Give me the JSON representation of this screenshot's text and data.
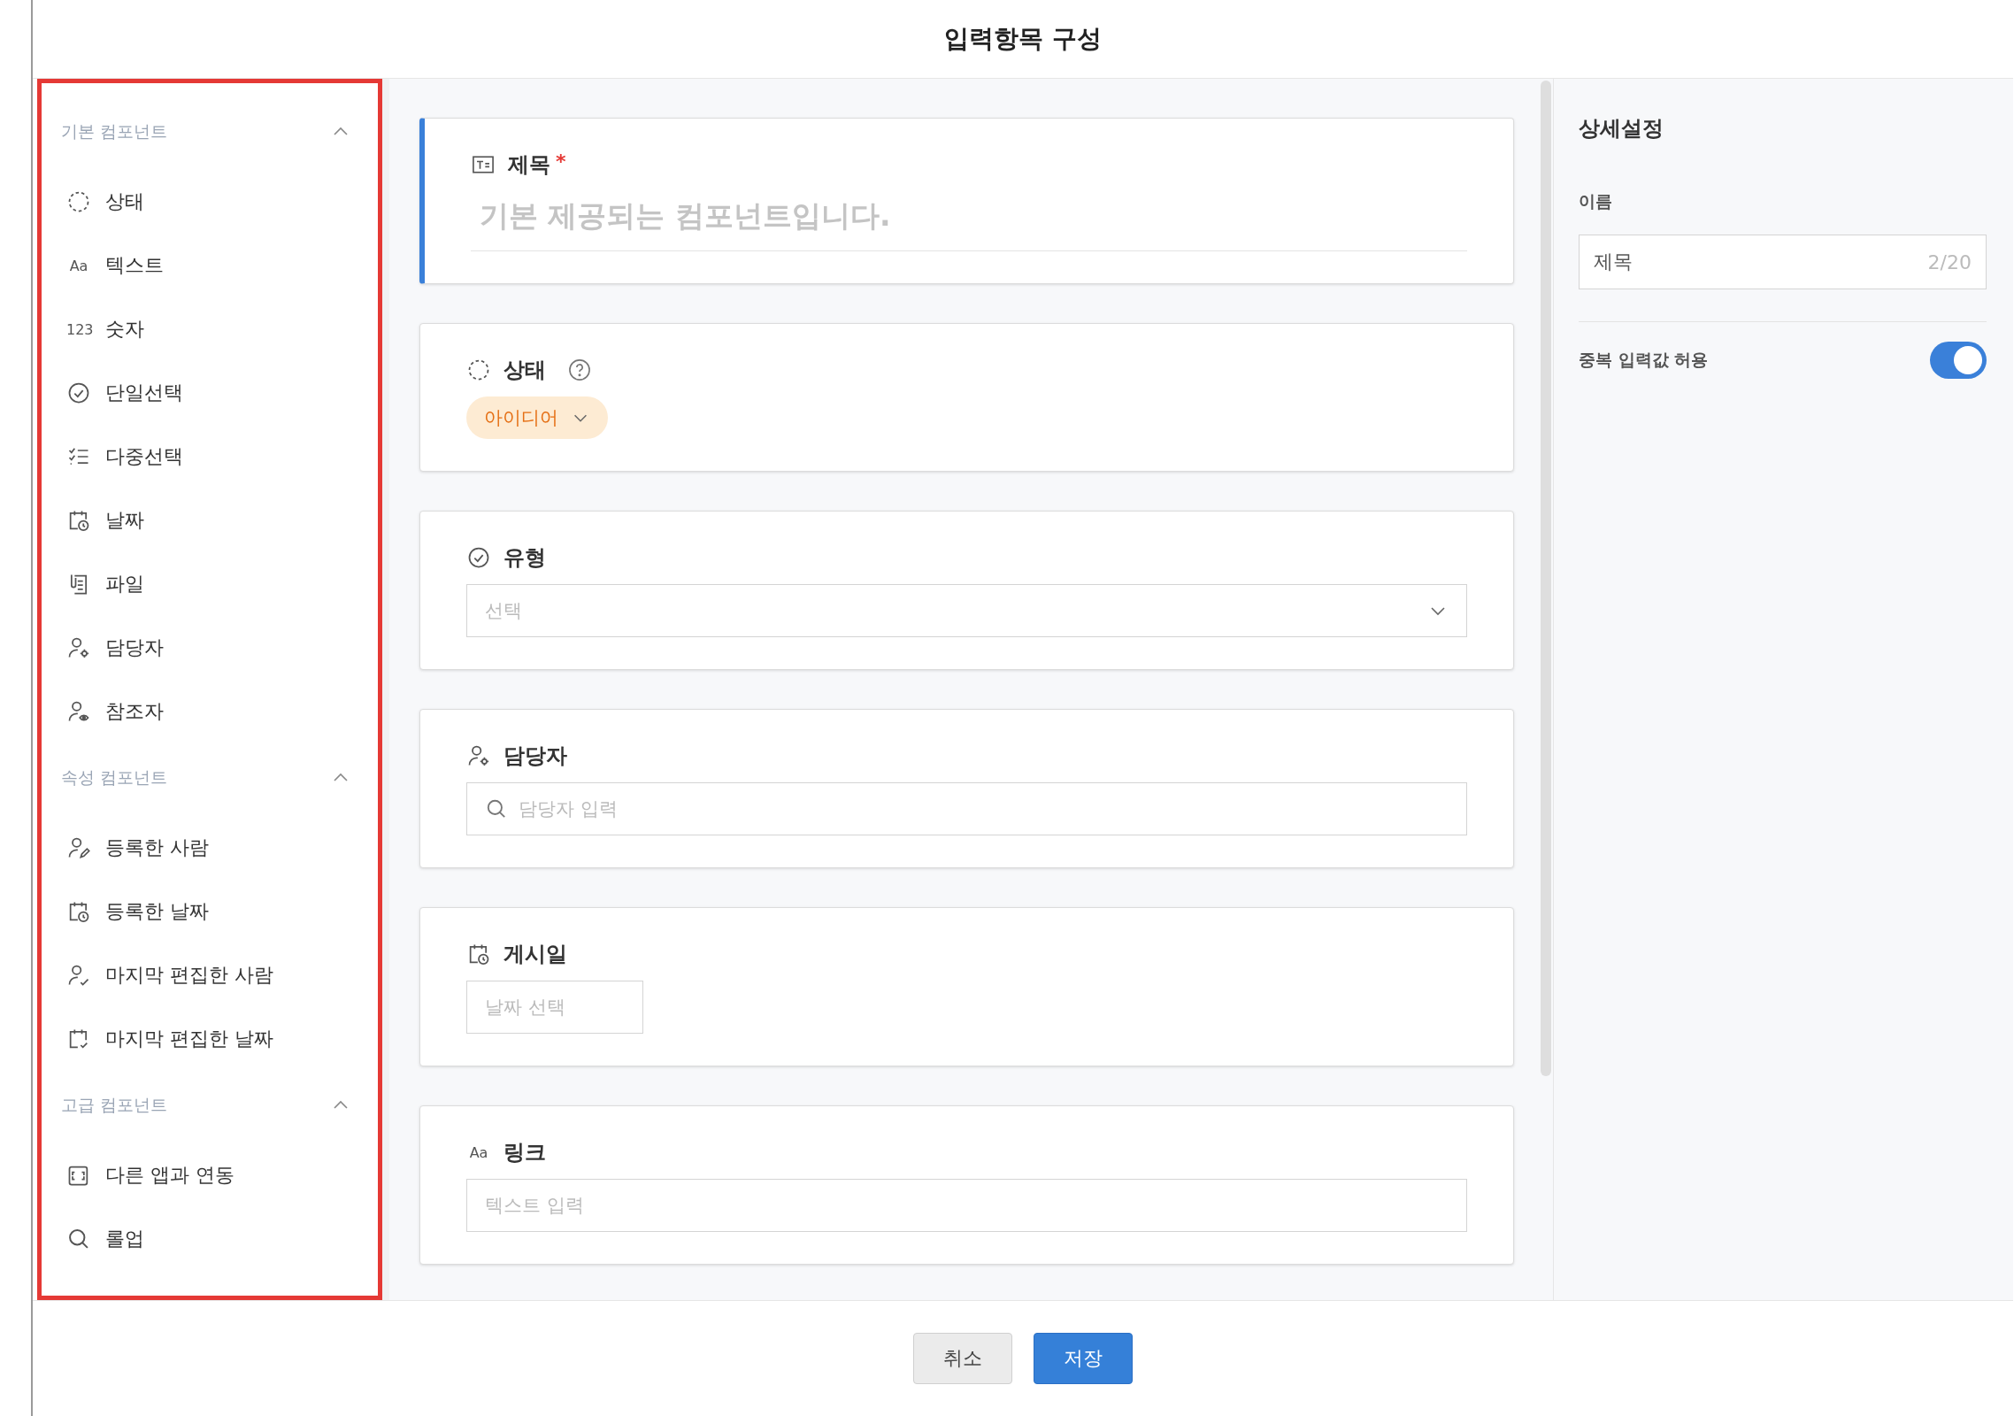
{
  "dialog": {
    "title": "입력항목 구성"
  },
  "sidebar": {
    "highlighted": true,
    "sections": [
      {
        "title": "기본 컴포넌트",
        "expanded": true,
        "items": [
          {
            "kind": "status",
            "label": "상태"
          },
          {
            "kind": "text",
            "glyph": "Aa",
            "label": "텍스트"
          },
          {
            "kind": "number",
            "glyph": "123",
            "label": "숫자"
          },
          {
            "kind": "single_select",
            "label": "단일선택"
          },
          {
            "kind": "multi_select",
            "label": "다중선택"
          },
          {
            "kind": "date",
            "label": "날짜"
          },
          {
            "kind": "file",
            "label": "파일"
          },
          {
            "kind": "assignee",
            "label": "담당자"
          },
          {
            "kind": "referrer",
            "label": "참조자"
          }
        ]
      },
      {
        "title": "속성 컴포넌트",
        "expanded": true,
        "items": [
          {
            "kind": "created_by",
            "label": "등록한 사람"
          },
          {
            "kind": "date",
            "label": "등록한 날짜"
          },
          {
            "kind": "edited_by",
            "label": "마지막 편집한 사람"
          },
          {
            "kind": "edited_at",
            "label": "마지막 편집한 날짜"
          }
        ]
      },
      {
        "title": "고급 컴포넌트",
        "expanded": true,
        "items": [
          {
            "kind": "app_link",
            "label": "다른 앱과 연동"
          },
          {
            "kind": "lookup",
            "label": "롤업"
          }
        ]
      }
    ]
  },
  "cards": [
    {
      "kind": "title",
      "label": "제목",
      "required_mark": "*",
      "selected": true,
      "field": {
        "kind": "underline",
        "placeholder": "기본 제공되는 컴포넌트입니다."
      }
    },
    {
      "kind": "status",
      "label": "상태",
      "help": true,
      "selected": false,
      "field": {
        "kind": "pill",
        "value": "아이디어"
      }
    },
    {
      "kind": "single_select",
      "label": "유형",
      "selected": false,
      "field": {
        "kind": "select",
        "placeholder": "선택"
      }
    },
    {
      "kind": "assignee",
      "label": "담당자",
      "selected": false,
      "field": {
        "kind": "search",
        "placeholder": "담당자 입력"
      }
    },
    {
      "kind": "date",
      "label": "게시일",
      "selected": false,
      "field": {
        "kind": "date",
        "placeholder": "날짜 선택"
      }
    },
    {
      "kind": "text",
      "glyph": "Aa",
      "label": "링크",
      "selected": false,
      "field": {
        "kind": "text",
        "placeholder": "텍스트 입력"
      }
    }
  ],
  "details": {
    "title": "상세설정",
    "name_label": "이름",
    "name_value": "제목",
    "name_count": "2/20",
    "duplicate_label": "중복 입력값 허용",
    "duplicate_on": true
  },
  "footer": {
    "buttons": [
      {
        "kind": "secondary",
        "label": "취소"
      },
      {
        "kind": "primary",
        "label": "저장"
      }
    ]
  }
}
